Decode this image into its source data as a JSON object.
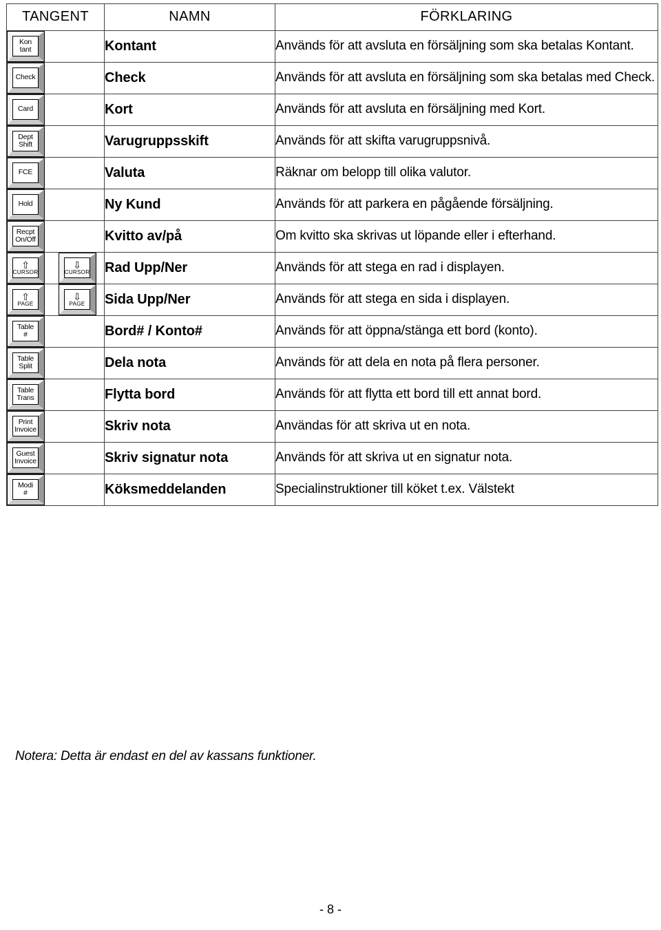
{
  "document": {
    "page_number": "- 8 -",
    "note": "Notera: Detta är endast en del av kassans funktioner."
  },
  "table": {
    "headers": {
      "key": "TANGENT",
      "name": "NAMN",
      "description": "FÖRKLARING"
    },
    "rows": [
      {
        "keys": [
          {
            "lines": [
              "Kon",
              "tant"
            ]
          }
        ],
        "name": "Kontant",
        "description": "Används för att avsluta en försäljning som ska betalas Kontant."
      },
      {
        "keys": [
          {
            "lines": [
              "Check"
            ]
          }
        ],
        "name": "Check",
        "description": "Används för att avsluta en försäljning som ska betalas med Check."
      },
      {
        "keys": [
          {
            "lines": [
              "Card"
            ]
          }
        ],
        "name": "Kort",
        "description": "Används för att avsluta en försäljning med Kort."
      },
      {
        "keys": [
          {
            "lines": [
              "Dept",
              "Shift"
            ]
          }
        ],
        "name": "Varugruppsskift",
        "description": "Används för att skifta varugruppsnivå."
      },
      {
        "keys": [
          {
            "lines": [
              "FCE"
            ]
          }
        ],
        "name": "Valuta",
        "description": "Räknar om belopp till olika valutor."
      },
      {
        "keys": [
          {
            "lines": [
              "Hold"
            ]
          }
        ],
        "name": "Ny Kund",
        "description": "Används för att parkera en pågående försäljning."
      },
      {
        "keys": [
          {
            "lines": [
              "Recpt",
              "On/Off"
            ]
          }
        ],
        "name": "Kvitto av/på",
        "description": "Om kvitto ska skrivas ut löpande eller i efterhand."
      },
      {
        "keys": [
          {
            "arrow": "⇧",
            "lines": [
              "CURSOR"
            ]
          },
          {
            "arrow": "⇩",
            "lines": [
              "CURSOR"
            ]
          }
        ],
        "name": "Rad Upp/Ner",
        "description": "Används för att stega en rad i displayen."
      },
      {
        "keys": [
          {
            "arrow": "⇧",
            "lines": [
              "PAGE"
            ]
          },
          {
            "arrow": "⇩",
            "lines": [
              "PAGE"
            ]
          }
        ],
        "name": "Sida Upp/Ner",
        "description": "Används för att stega en sida i displayen."
      },
      {
        "keys": [
          {
            "lines": [
              "Table",
              "#"
            ]
          }
        ],
        "name": "Bord# / Konto#",
        "description": "Används för att öppna/stänga ett bord (konto)."
      },
      {
        "keys": [
          {
            "lines": [
              "Table",
              "Split"
            ]
          }
        ],
        "name": "Dela nota",
        "description": "Används för att dela en nota på flera personer."
      },
      {
        "keys": [
          {
            "lines": [
              "Table",
              "Trans"
            ]
          }
        ],
        "name": "Flytta bord",
        "description": "Används för att flytta ett bord till ett annat bord."
      },
      {
        "keys": [
          {
            "lines": [
              "Print",
              "Invoice"
            ]
          }
        ],
        "name": "Skriv nota",
        "description": "Användas för att skriva ut en nota."
      },
      {
        "keys": [
          {
            "lines": [
              "Guest",
              "Invoice"
            ]
          }
        ],
        "name": "Skriv signatur nota",
        "description": "Används för att skriva ut en signatur nota."
      },
      {
        "keys": [
          {
            "lines": [
              "Modi",
              "#"
            ]
          }
        ],
        "name": "Köksmeddelanden",
        "description": "Specialinstruktioner till köket t.ex. Välstekt"
      }
    ]
  }
}
